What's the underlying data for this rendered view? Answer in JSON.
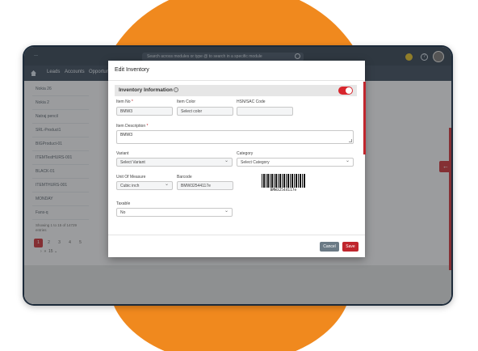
{
  "app": {
    "search_placeholder": "Search across modules or type @ to search in a specific module",
    "nav": [
      "Leads",
      "Accounts",
      "Opportuniti"
    ]
  },
  "sidebar": {
    "items": [
      "Nokia 26",
      "Nokia 2",
      "Natraj pencil",
      "SRL-Product1",
      "BIGProduct-01",
      "ITEMTestHURS-001",
      "BLACK-01",
      "ITEMTHURS-001",
      "MONDAY",
      "Fans-q"
    ],
    "showing": "Showing 1 to 15 of 14729 entries",
    "pages": [
      "1",
      "2",
      "3",
      "4",
      "5"
    ],
    "page_size": "15"
  },
  "modal": {
    "title": "Edit Inventory",
    "section_title": "Inventory Information",
    "fields": {
      "item_no": {
        "label": "Item No",
        "required": "*",
        "value": "BMW3"
      },
      "item_color": {
        "label": "Item Color",
        "value": "Select color"
      },
      "hsn": {
        "label": "HSN/SAC Code",
        "value": ""
      },
      "item_description": {
        "label": "Item Description",
        "required": "*",
        "value": "BMW3"
      },
      "variant": {
        "label": "Variant",
        "value": "Select Variant"
      },
      "category": {
        "label": "Category",
        "value": "Select Category"
      },
      "unit_of_measure": {
        "label": "Unit Of Measure",
        "value": "Cubic inch"
      },
      "barcode": {
        "label": "Barcode",
        "value": "BMW32544117e"
      },
      "taxable": {
        "label": "Taxable",
        "value": "No"
      }
    },
    "barcode_text": "BMW32544117e",
    "cancel_label": "Cancel",
    "save_label": "Save"
  },
  "colors": {
    "accent": "#c0262d",
    "decor_circle": "#f0891e"
  }
}
